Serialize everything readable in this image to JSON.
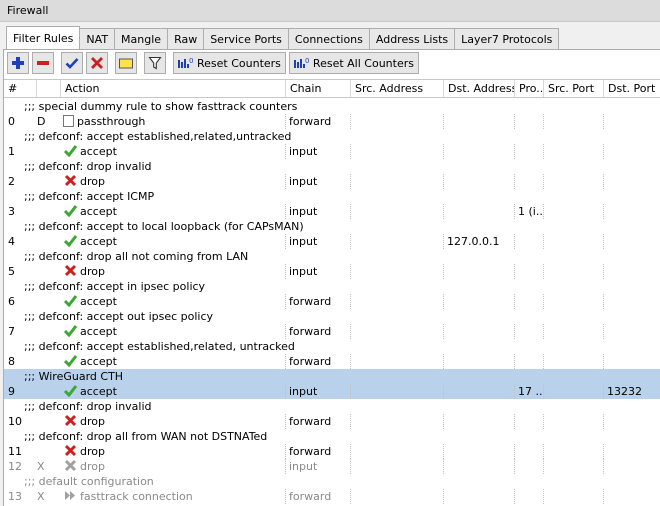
{
  "window": {
    "title": "Firewall"
  },
  "tabs": [
    {
      "label": "Filter Rules",
      "active": true
    },
    {
      "label": "NAT"
    },
    {
      "label": "Mangle"
    },
    {
      "label": "Raw"
    },
    {
      "label": "Service Ports"
    },
    {
      "label": "Connections"
    },
    {
      "label": "Address Lists"
    },
    {
      "label": "Layer7 Protocols"
    }
  ],
  "toolbar": {
    "reset_counters": "Reset Counters",
    "reset_all_counters": "Reset All Counters"
  },
  "columns": {
    "num": "#",
    "action": "Action",
    "chain": "Chain",
    "src_address": "Src. Address",
    "dst_address": "Dst. Address",
    "protocol": "Pro...",
    "src_port": "Src. Port",
    "dst_port": "Dst. Port"
  },
  "rows": [
    {
      "comment": ";;; special dummy rule to show fasttrack counters"
    },
    {
      "num": "0",
      "flag": "D",
      "action": "passthrough",
      "icon": "passthrough",
      "chain": "forward"
    },
    {
      "comment": ";;; defconf: accept established,related,untracked"
    },
    {
      "num": "1",
      "action": "accept",
      "icon": "accept",
      "chain": "input"
    },
    {
      "comment": ";;; defconf: drop invalid"
    },
    {
      "num": "2",
      "action": "drop",
      "icon": "drop",
      "chain": "input"
    },
    {
      "comment": ";;; defconf: accept ICMP"
    },
    {
      "num": "3",
      "action": "accept",
      "icon": "accept",
      "chain": "input",
      "protocol": "1 (i..."
    },
    {
      "comment": ";;; defconf: accept to local loopback (for CAPsMAN)"
    },
    {
      "num": "4",
      "action": "accept",
      "icon": "accept",
      "chain": "input",
      "dst_address": "127.0.0.1"
    },
    {
      "comment": ";;; defconf: drop all not coming from LAN"
    },
    {
      "num": "5",
      "action": "drop",
      "icon": "drop",
      "chain": "input"
    },
    {
      "comment": ";;; defconf: accept in ipsec policy"
    },
    {
      "num": "6",
      "action": "accept",
      "icon": "accept",
      "chain": "forward"
    },
    {
      "comment": ";;; defconf: accept out ipsec policy"
    },
    {
      "num": "7",
      "action": "accept",
      "icon": "accept",
      "chain": "forward"
    },
    {
      "comment": ";;; defconf: accept established,related, untracked"
    },
    {
      "num": "8",
      "action": "accept",
      "icon": "accept",
      "chain": "forward"
    },
    {
      "comment": ";;; WireGuard CTH",
      "selected": true
    },
    {
      "num": "9",
      "action": "accept",
      "icon": "accept",
      "chain": "input",
      "protocol": "17 ...",
      "dst_port": "13232",
      "selected": true
    },
    {
      "comment": ";;; defconf: drop invalid"
    },
    {
      "num": "10",
      "action": "drop",
      "icon": "drop",
      "chain": "forward"
    },
    {
      "comment": ";;; defconf: drop all from WAN not DSTNATed"
    },
    {
      "num": "11",
      "action": "drop",
      "icon": "drop",
      "chain": "forward"
    },
    {
      "num": "12",
      "flag": "X",
      "action": "drop",
      "icon": "drop",
      "chain": "input",
      "disabled": true
    },
    {
      "comment": ";;; default configuration",
      "disabled": true
    },
    {
      "num": "13",
      "flag": "X",
      "action": "fasttrack connection",
      "icon": "fasttrack",
      "chain": "forward",
      "disabled": true
    }
  ],
  "colors": {
    "selected_row": "#b9d1ea",
    "accept_icon": "#3aa832",
    "drop_icon": "#cc1f1f",
    "add_icon": "#1d3fb8",
    "disabled_text": "#8a8a8a"
  }
}
